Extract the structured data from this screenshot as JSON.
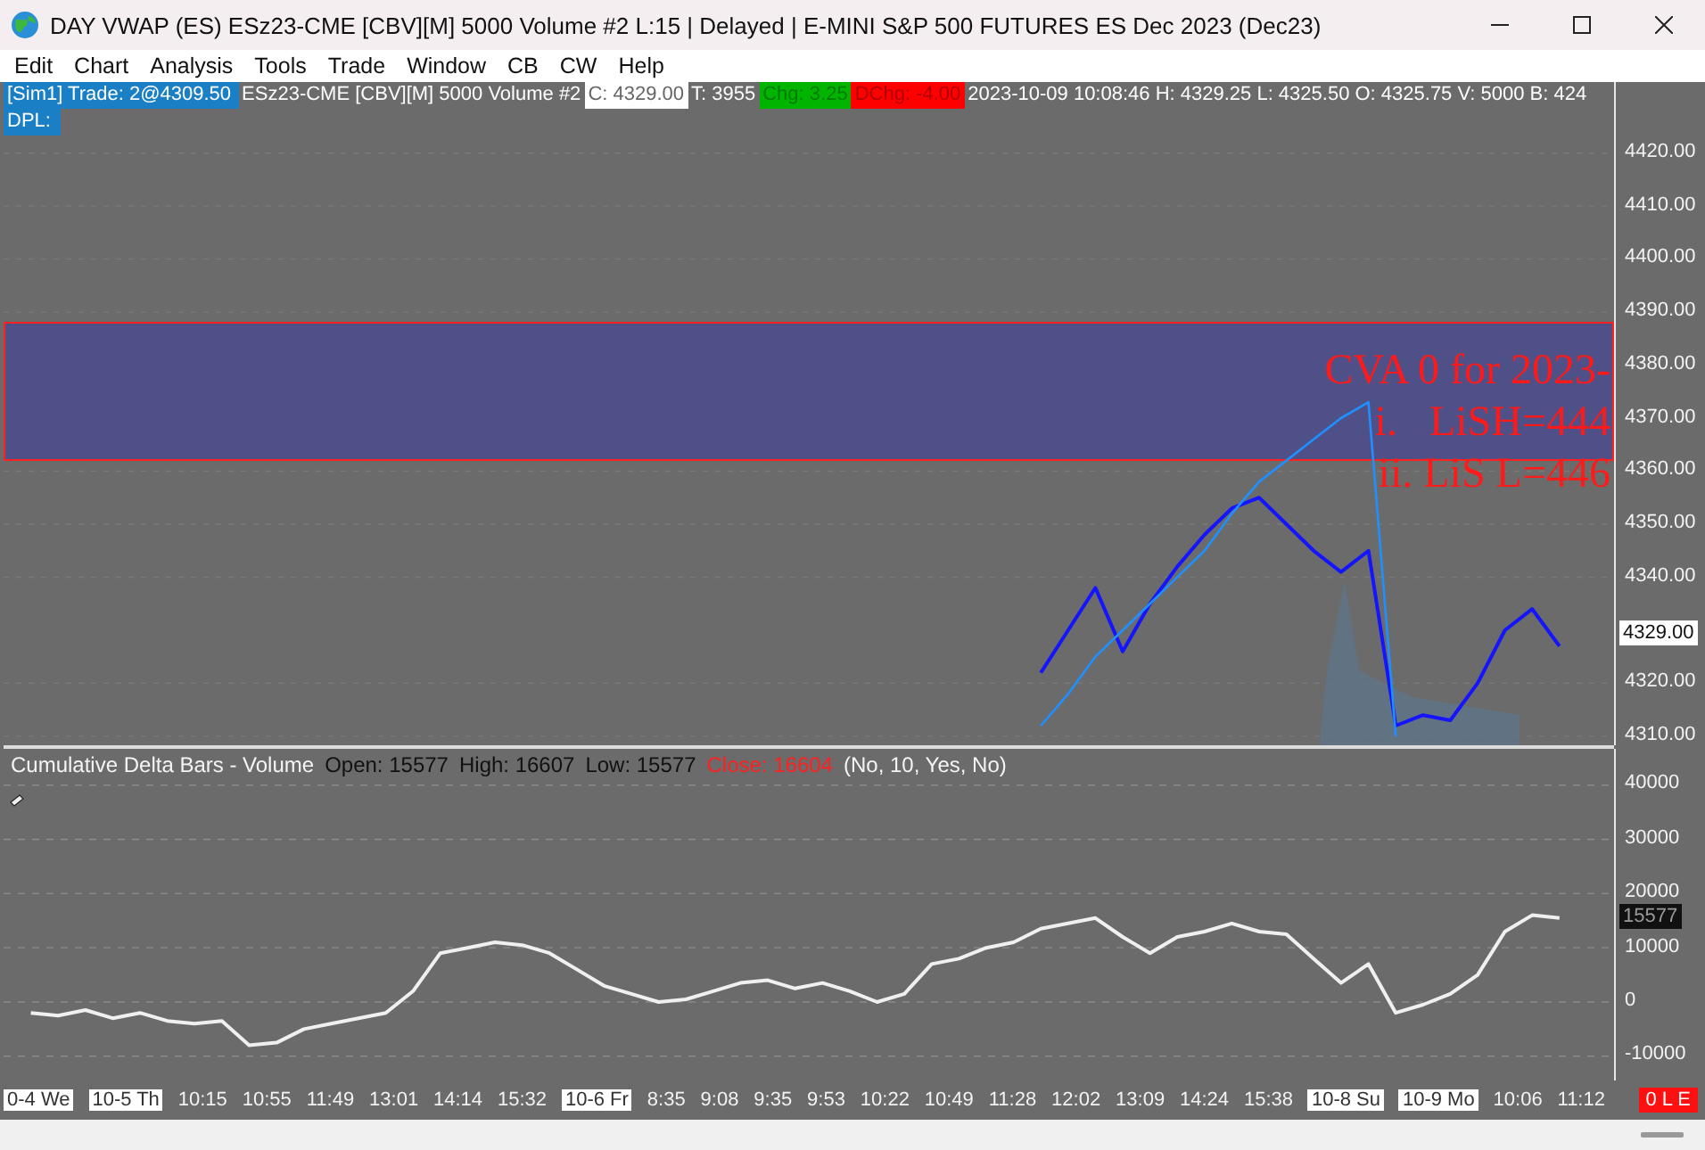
{
  "window": {
    "title": "DAY VWAP (ES) ESz23-CME [CBV][M]  5000 Volume #2 L:15 | Delayed | E-MINI S&P 500 FUTURES ES Dec 2023 (Dec23)"
  },
  "menu": [
    "Edit",
    "Chart",
    "Analysis",
    "Tools",
    "Trade",
    "Window",
    "CB",
    "CW",
    "Help"
  ],
  "info_bar": [
    {
      "kind": "account",
      "text": "[Sim1]  Trade: 2@4309.50"
    },
    {
      "kind": "plain",
      "text": "ESz23-CME [CBV][M]  5000 Volume #2"
    },
    {
      "kind": "close",
      "text": "C: 4329.00"
    },
    {
      "kind": "plain",
      "text": "T: 3955"
    },
    {
      "kind": "up",
      "text": "Chg: 3.25"
    },
    {
      "kind": "down",
      "text": "DChg: -4.00"
    },
    {
      "kind": "plain",
      "text": "2023-10-09 10:08:46 H: 4329.25 L: 4325.50 O: 4325.75 V: 5000 B: 424"
    }
  ],
  "dpl_label": "DPL:",
  "price_panel": {
    "last_price": "4329.00",
    "chart_data": {
      "type": "line",
      "ylim": [
        4308.3,
        4433.4
      ],
      "yticks": [
        {
          "value": 4420,
          "label": "4420.00"
        },
        {
          "value": 4410,
          "label": "4410.00"
        },
        {
          "value": 4400,
          "label": "4400.00"
        },
        {
          "value": 4390,
          "label": "4390.00"
        },
        {
          "value": 4380,
          "label": "4380.00"
        },
        {
          "value": 4370,
          "label": "4370.00"
        },
        {
          "value": 4360,
          "label": "4360.00"
        },
        {
          "value": 4350,
          "label": "4350.00"
        },
        {
          "value": 4340,
          "label": "4340.00"
        },
        {
          "value": 4320,
          "label": "4320.00"
        },
        {
          "value": 4310,
          "label": "4310.00"
        }
      ],
      "series": [
        {
          "color": "#1414ff",
          "values": [
            null,
            null,
            null,
            null,
            null,
            null,
            null,
            null,
            null,
            null,
            null,
            null,
            null,
            null,
            null,
            null,
            null,
            null,
            null,
            null,
            null,
            null,
            null,
            null,
            null,
            null,
            null,
            null,
            null,
            null,
            null,
            null,
            null,
            null,
            null,
            null,
            null,
            null,
            4322,
            4330,
            4338,
            4326,
            4335,
            4342,
            4348,
            4353,
            4355,
            4350,
            4345,
            4341,
            4345,
            4312,
            4314,
            4313,
            4320,
            4330,
            4334,
            4327,
            null,
            null
          ]
        },
        {
          "color": "#1e90ff",
          "values": [
            null,
            null,
            null,
            null,
            null,
            null,
            null,
            null,
            null,
            null,
            null,
            null,
            null,
            null,
            null,
            null,
            null,
            null,
            null,
            null,
            null,
            null,
            null,
            null,
            null,
            null,
            null,
            null,
            null,
            null,
            null,
            null,
            null,
            null,
            null,
            null,
            null,
            null,
            4312,
            4318,
            4325,
            4330,
            4335,
            4340,
            4345,
            4352,
            4358,
            4362,
            4366,
            4370,
            4373,
            4310,
            null,
            null,
            null,
            null,
            null,
            null,
            null,
            null
          ]
        }
      ],
      "grid": true,
      "annotations": [
        "CVA 0 for 2023-",
        "i.   LiSH=444",
        "ii. LiS L=446"
      ]
    }
  },
  "delta_panel": {
    "header": [
      {
        "kind": "title",
        "text": "Cumulative Delta Bars - Volume"
      },
      {
        "kind": "stat",
        "text": "Open: 15577"
      },
      {
        "kind": "stat",
        "text": "High: 16607"
      },
      {
        "kind": "stat",
        "text": "Low: 15577"
      },
      {
        "kind": "close",
        "text": "Close: 16604"
      },
      {
        "kind": "title",
        "text": "(No, 10, Yes, No)"
      }
    ],
    "last_value": "15577",
    "chart_data": {
      "type": "line",
      "grid": true,
      "ylim": [
        -14480,
        46700
      ],
      "yticks": [
        {
          "value": 40000,
          "label": "40000"
        },
        {
          "value": 30000,
          "label": "30000"
        },
        {
          "value": 20000,
          "label": "20000"
        },
        {
          "value": 10000,
          "label": "10000"
        },
        {
          "value": 0,
          "label": "0"
        },
        {
          "value": -10000,
          "label": "-10000"
        }
      ],
      "series": [
        {
          "color": "#f0f0f0",
          "values": [
            null,
            -2000,
            -2500,
            -1500,
            -3000,
            -2000,
            -3500,
            -4000,
            -3500,
            -8000,
            -7500,
            -5000,
            -4000,
            -3000,
            -2000,
            2000,
            9000,
            10000,
            11000,
            10500,
            9000,
            6000,
            3000,
            1500,
            0,
            500,
            2000,
            3500,
            4000,
            2500,
            3500,
            2000,
            0,
            1500,
            7000,
            8000,
            10000,
            11000,
            13500,
            14500,
            15500,
            12000,
            9000,
            12000,
            13000,
            14500,
            13000,
            12500,
            8000,
            3500,
            7000,
            -2000,
            -500,
            1500,
            5000,
            13000,
            16000,
            15500,
            null,
            null
          ]
        }
      ]
    }
  },
  "time_axis": [
    {
      "kind": "day",
      "text": "0-4 We"
    },
    {
      "kind": "day",
      "text": "10-5 Th"
    },
    {
      "kind": "time",
      "text": "10:15"
    },
    {
      "kind": "time",
      "text": "10:55"
    },
    {
      "kind": "time",
      "text": "11:49"
    },
    {
      "kind": "time",
      "text": "13:01"
    },
    {
      "kind": "time",
      "text": "14:14"
    },
    {
      "kind": "time",
      "text": "15:32"
    },
    {
      "kind": "day",
      "text": "10-6 Fr"
    },
    {
      "kind": "time",
      "text": "8:35"
    },
    {
      "kind": "time",
      "text": "9:08"
    },
    {
      "kind": "time",
      "text": "9:35"
    },
    {
      "kind": "time",
      "text": "9:53"
    },
    {
      "kind": "time",
      "text": "10:22"
    },
    {
      "kind": "time",
      "text": "10:49"
    },
    {
      "kind": "time",
      "text": "11:28"
    },
    {
      "kind": "time",
      "text": "12:02"
    },
    {
      "kind": "time",
      "text": "13:09"
    },
    {
      "kind": "time",
      "text": "14:24"
    },
    {
      "kind": "time",
      "text": "15:38"
    },
    {
      "kind": "day",
      "text": "10-8 Su"
    },
    {
      "kind": "day",
      "text": "10-9 Mo"
    },
    {
      "kind": "time",
      "text": "10:06"
    },
    {
      "kind": "time",
      "text": "11:12"
    }
  ],
  "status_badge": "0 L E"
}
